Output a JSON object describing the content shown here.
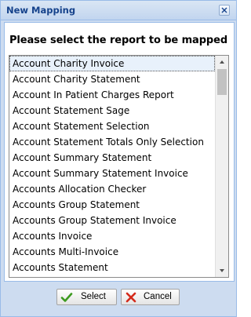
{
  "dialog": {
    "title": "New Mapping",
    "prompt": "Please select the report to be mapped",
    "selected_index": 0,
    "reports": [
      "Account Charity Invoice",
      "Account Charity Statement",
      "Account In Patient Charges Report",
      "Account Statement Sage",
      "Account Statement Selection",
      "Account Statement Totals Only Selection",
      "Account Summary Statement",
      "Account Summary Statement Invoice",
      "Accounts Allocation Checker",
      "Accounts Group Statement",
      "Accounts Group Statement Invoice",
      "Accounts Invoice",
      "Accounts Multi-Invoice",
      "Accounts Statement"
    ],
    "buttons": {
      "select": "Select",
      "cancel": "Cancel"
    },
    "icons": {
      "close": "close-icon",
      "select": "checkmark-icon",
      "cancel": "cross-icon"
    },
    "colors": {
      "title_text": "#15428b",
      "frame": "#cddcf0",
      "border": "#99bbe8",
      "check": "#3c9a1f",
      "cross": "#d42a1b"
    }
  }
}
